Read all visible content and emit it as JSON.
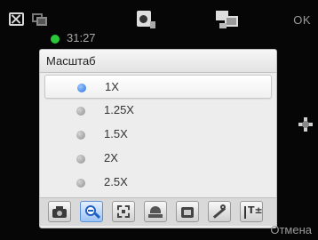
{
  "status_bar": {
    "time": "31:27",
    "ok_label": "OK",
    "icons": {
      "close": "close-icon",
      "gallery": "gallery-icon",
      "mode": "video-camera-icon",
      "settings": "settings-icon"
    }
  },
  "dialog": {
    "title": "Масштаб",
    "options": [
      {
        "label": "1X",
        "selected": true
      },
      {
        "label": "1.25X",
        "selected": false
      },
      {
        "label": "1.5X",
        "selected": false
      },
      {
        "label": "2X",
        "selected": false
      },
      {
        "label": "2.5X",
        "selected": false
      }
    ]
  },
  "toolbar": {
    "tools": [
      {
        "name": "shooting-mode-icon",
        "active": false
      },
      {
        "name": "zoom-icon",
        "active": true
      },
      {
        "name": "focus-icon",
        "active": false
      },
      {
        "name": "white-balance-icon",
        "active": false
      },
      {
        "name": "effects-icon",
        "active": false
      },
      {
        "name": "tools-icon",
        "active": false
      },
      {
        "name": "exposure-icon",
        "active": false
      }
    ],
    "exposure_glyph": "T±"
  },
  "softkeys": {
    "cancel_label": "Отмена"
  },
  "colors": {
    "background": "#060606",
    "dialog_bg": "#ededed",
    "selected_radio": "#2a6fe0",
    "recording_dot": "#28c83a",
    "active_tool": "#9cc3f5"
  }
}
